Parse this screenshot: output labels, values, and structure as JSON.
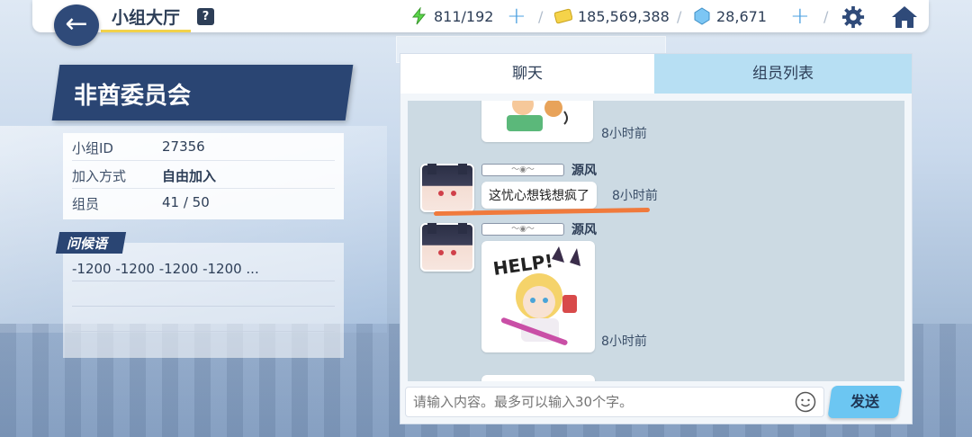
{
  "header": {
    "title": "小组大厅",
    "help": "?",
    "back_icon": "arrow-left-icon",
    "ap": "811/192",
    "credits": "185,569,388",
    "gems": "28,671",
    "plus": "+",
    "sep": "/"
  },
  "club": {
    "name": "非酋委员会",
    "info": [
      {
        "key": "小组ID",
        "value": "27356"
      },
      {
        "key": "加入方式",
        "value": "自由加入"
      },
      {
        "key": "组员",
        "value": "41 / 50"
      }
    ],
    "greeting_label": "问候语",
    "greeting_text": "-1200 -1200 -1200 -1200 ..."
  },
  "tabs": {
    "chat": "聊天",
    "members": "组员列表"
  },
  "messages": [
    {
      "sender": "",
      "time": "8小时前",
      "kind": "sticker"
    },
    {
      "sender": "源风",
      "time": "8小时前",
      "text": "这忧心想钱想疯了"
    },
    {
      "sender": "源风",
      "time": "8小时前",
      "kind": "sticker",
      "sticker_text": "HELP!"
    }
  ],
  "input": {
    "placeholder": "请输入内容。最多可以输入30个字。",
    "send": "发送"
  },
  "colors": {
    "navy": "#2a4573",
    "accent_blue": "#6cc6f2",
    "tab_inactive": "#b7dff3",
    "annotation_orange": "#f07a3c"
  }
}
